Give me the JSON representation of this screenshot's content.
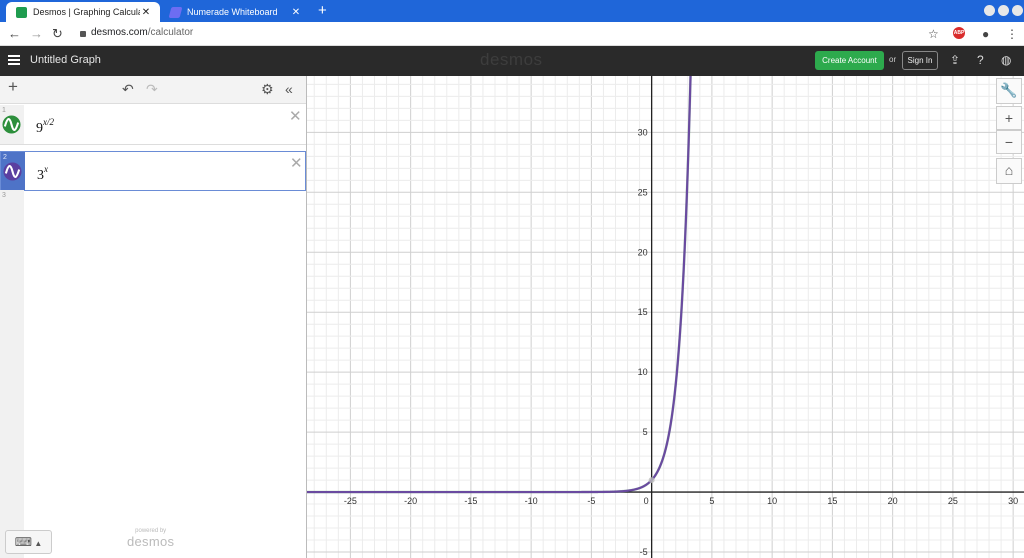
{
  "browser": {
    "tabs": [
      {
        "title": "Desmos | Graphing Calculator",
        "close": "✕"
      },
      {
        "title": "Numerade Whiteboard",
        "close": "✕"
      }
    ],
    "new_tab": "+",
    "url_host": "desmos.com",
    "url_path": "/calculator",
    "adblock_label": "ABP"
  },
  "header": {
    "graph_title": "Untitled Graph",
    "logo": "desmos",
    "create_account": "Create Account",
    "or": "or",
    "sign_in": "Sign In"
  },
  "expressions": [
    {
      "index": "1",
      "base": "9",
      "exponent": "x/2",
      "color": "#2d8f3c"
    },
    {
      "index": "2",
      "base": "3",
      "exponent": "x",
      "color": "#5b3fa0"
    }
  ],
  "empty_index": "3",
  "powered_by": {
    "line1": "powered by",
    "line2": "desmos"
  },
  "graph": {
    "curve_color": "#6a4aa0",
    "x_ticks": [
      "-25",
      "-20",
      "-15",
      "-10",
      "-5",
      "0",
      "5",
      "10",
      "15",
      "20",
      "25",
      "30"
    ],
    "y_ticks": [
      "30",
      "25",
      "20",
      "15",
      "10",
      "5",
      "-5"
    ],
    "xlim": [
      -28.6,
      30.9
    ],
    "ylim": [
      -5.5,
      34.7
    ]
  }
}
